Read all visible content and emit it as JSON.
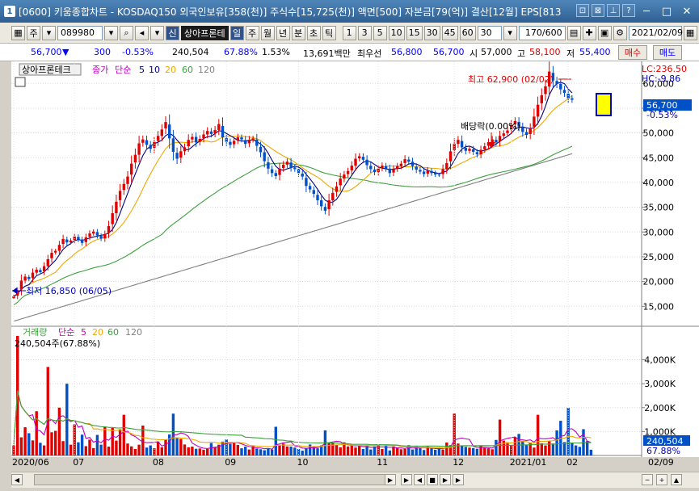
{
  "window": {
    "badge": "1",
    "title": "[0600] 키움종합차트 - KOSDAQ150 외국인보유[358(천)] 주식수[15,725(천)] 액면[500] 자본금[79(억)] 결산[12월] EPS[813"
  },
  "toolbar": {
    "period_label": "주",
    "stock_code": "089980",
    "stock_name": "상아프론테",
    "credit_badge": "신",
    "period_tabs": [
      "일",
      "주",
      "월",
      "년",
      "분",
      "초",
      "틱"
    ],
    "active_tab": "일",
    "minute_options": [
      "1",
      "3",
      "5",
      "10",
      "15",
      "30",
      "45",
      "60"
    ],
    "minute_select": "30",
    "count": "170/600",
    "date": "2021/02/09"
  },
  "quote": {
    "price": "56,700",
    "change": "300",
    "change_pct": "-0.53%",
    "volume": "240,504",
    "volume_ratio": "67.88%",
    "turnover": "1.53%",
    "trade_value": "13,691백만",
    "best_ask_label": "최우선",
    "best_ask": "56,800",
    "best_bid": "56,700",
    "open_label": "시",
    "open": "57,000",
    "high_label": "고",
    "high": "58,100",
    "low_label": "저",
    "low": "55,400",
    "buy_label": "매수",
    "sell_label": "매도"
  },
  "chart_data": [
    {
      "type": "candlestick",
      "title": "상아프론테크",
      "legend": [
        "종가",
        "단순",
        "5",
        "10",
        "20",
        "60",
        "120"
      ],
      "x_labels": [
        "2020/06",
        "07",
        "08",
        "09",
        "10",
        "11",
        "12",
        "2021/01",
        "02"
      ],
      "y_ticks": [
        15000,
        20000,
        25000,
        30000,
        35000,
        40000,
        45000,
        50000,
        55000,
        60000
      ],
      "y_tick_labels": [
        "15,000",
        "20,000",
        "25,000",
        "30,000",
        "35,000",
        "40,000",
        "45,000",
        "50,000",
        "55,000",
        "60,000"
      ],
      "ylim": [
        11300,
        63800
      ],
      "series_colors": {
        "up": "#e00000",
        "down": "#0050c8",
        "ma5": "#000080",
        "ma20": "#f0a800",
        "ma60": "#3ca03c",
        "ma120": "#808080"
      },
      "closes": [
        17000,
        18100,
        20200,
        21000,
        20500,
        21800,
        22400,
        21900,
        23100,
        24500,
        25800,
        26200,
        27400,
        28600,
        27900,
        28300,
        29100,
        28500,
        27800,
        28900,
        29700,
        30100,
        29300,
        28700,
        29600,
        31200,
        33800,
        36100,
        38300,
        39700,
        41200,
        43800,
        45600,
        47900,
        48700,
        47600,
        46800,
        48200,
        49400,
        50700,
        52200,
        48900,
        46200,
        44800,
        46300,
        47100,
        48600,
        49200,
        48100,
        48800,
        49700,
        50400,
        49800,
        50600,
        51800,
        49100,
        48200,
        47600,
        48400,
        49100,
        48700,
        47800,
        48600,
        48900,
        47400,
        46100,
        44300,
        42800,
        41900,
        41300,
        42800,
        43600,
        44200,
        43100,
        42700,
        41900,
        41200,
        39300,
        38600,
        37700,
        36400,
        35200,
        34300,
        36400,
        37900,
        39200,
        40800,
        41600,
        42300,
        43400,
        44800,
        45300,
        44600,
        43500,
        42700,
        42100,
        42800,
        43400,
        42800,
        41900,
        42700,
        43300,
        43800,
        44700,
        44200,
        43300,
        42600,
        42200,
        41700,
        42400,
        41900,
        41600,
        41500,
        42700,
        43900,
        46300,
        47800,
        48600,
        47100,
        46400,
        46800,
        46200,
        45700,
        46600,
        47300,
        48100,
        48700,
        48100,
        49400,
        49900,
        50500,
        51700,
        52400,
        51300,
        50200,
        49600,
        50900,
        53300,
        55700,
        57600,
        59400,
        62400,
        60600,
        59900,
        58800,
        58100,
        57000,
        56700
      ],
      "annotations": [
        {
          "label": "최고 62,900 (02/02)",
          "value": 62900
        },
        {
          "label": "최저 16,850 (06/05)",
          "value": 16850
        },
        {
          "label": "배당락(0.00%)"
        }
      ],
      "right_panel": {
        "lc": "LC:236.50",
        "hc": "HC:-9.86",
        "price": "56,700",
        "change": "-0.53%"
      }
    },
    {
      "type": "bar",
      "title": "거래량",
      "legend": [
        "거래량",
        "단순",
        "5",
        "20",
        "60",
        "120"
      ],
      "current_label": "240,504주(67.88%)",
      "current_value": 240504,
      "ylim": [
        0,
        5200000
      ],
      "y_ticks": [
        1000000,
        2000000,
        3000000,
        4000000
      ],
      "y_tick_labels": [
        "1,000K",
        "2,000K",
        "3,000K",
        "4,000K"
      ],
      "right_value": "240,504",
      "right_ratio": "67.88%",
      "x_labels": [
        "2020/06",
        "07",
        "08",
        "09",
        "10",
        "11",
        "12",
        "2021/01",
        "02"
      ],
      "end_date_label": "02/09",
      "values": [
        420000,
        5000000,
        760000,
        1180000,
        930000,
        630000,
        1850000,
        530000,
        420000,
        3700000,
        970000,
        1030000,
        2000000,
        600000,
        3000000,
        450000,
        1300000,
        550000,
        870000,
        390000,
        660000,
        310000,
        860000,
        450000,
        1200000,
        370000,
        1150000,
        620000,
        1100000,
        1700000,
        500000,
        380000,
        270000,
        450000,
        1250000,
        330000,
        420000,
        300000,
        580000,
        340000,
        670000,
        880000,
        1750000,
        720000,
        690000,
        460000,
        340000,
        370000,
        280000,
        290000,
        240000,
        270000,
        520000,
        360000,
        450000,
        580000,
        670000,
        480000,
        520000,
        440000,
        300000,
        370000,
        250000,
        390000,
        290000,
        260000,
        220000,
        300000,
        250000,
        1200000,
        420000,
        500000,
        380000,
        370000,
        330000,
        270000,
        200000,
        310000,
        460000,
        380000,
        300000,
        420000,
        1050000,
        530000,
        520000,
        450000,
        340000,
        550000,
        380000,
        420000,
        330000,
        420000,
        270000,
        430000,
        250000,
        380000,
        460000,
        270000,
        400000,
        210000,
        380000,
        330000,
        260000,
        270000,
        430000,
        250000,
        400000,
        310000,
        230000,
        370000,
        300000,
        240000,
        290000,
        250000,
        540000,
        430000,
        1750000,
        500000,
        420000,
        360000,
        330000,
        310000,
        280000,
        400000,
        340000,
        300000,
        260000,
        650000,
        1500000,
        620000,
        550000,
        430000,
        770000,
        900000,
        610000,
        430000,
        540000,
        330000,
        1700000,
        510000,
        420000,
        600000,
        500000,
        1050000,
        1450000,
        560000,
        1990000,
        510000,
        420000,
        360000,
        1100000,
        600000,
        240504
      ]
    }
  ],
  "nav": {
    "arrows": [
      "◀",
      "▶"
    ],
    "controls": [
      "▶",
      "◀",
      "■",
      "▶",
      "▶"
    ]
  }
}
